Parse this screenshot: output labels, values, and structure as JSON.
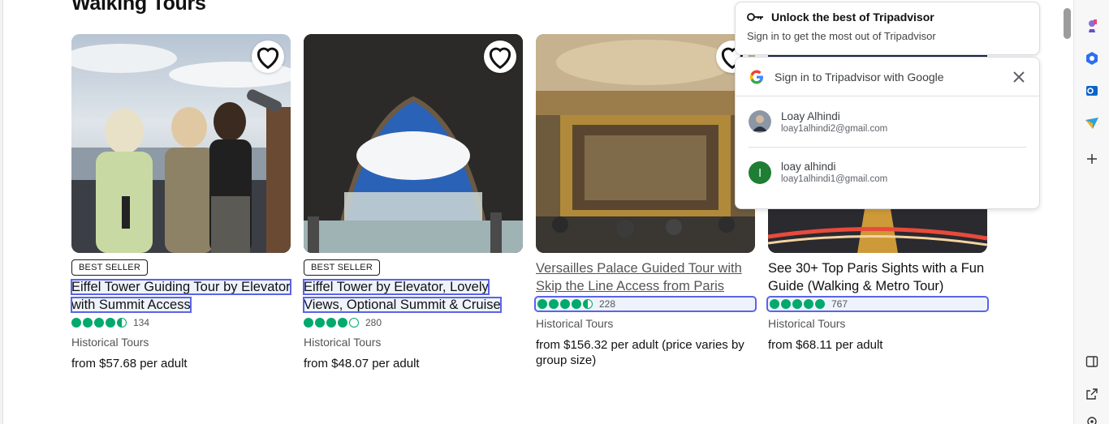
{
  "section": {
    "title": "Walking Tours"
  },
  "cards": [
    {
      "badge": "BEST SELLER",
      "title": "Eiffel Tower Guiding Tour by Elevator with Summit Access",
      "rating": 4.5,
      "reviews": "134",
      "category": "Historical Tours",
      "price": "from $57.68 per adult"
    },
    {
      "badge": "BEST SELLER",
      "title": "Eiffel Tower by Elevator, Lovely Views, Optional Summit & Cruise",
      "rating": 4,
      "reviews": "280",
      "category": "Historical Tours",
      "price": "from $48.07 per adult"
    },
    {
      "badge": "",
      "title": "Versailles Palace Guided Tour with Skip the Line Access from Paris",
      "rating": 4.5,
      "reviews": "228",
      "category": "Historical Tours",
      "price": "from $156.32 per adult (price varies by group size)"
    },
    {
      "badge": "",
      "title": "See 30+ Top Paris Sights with a Fun Guide (Walking & Metro Tour)",
      "rating": 5,
      "reviews": "767",
      "category": "Historical Tours",
      "price": "from $68.11 per adult"
    }
  ],
  "promo": {
    "heading": "Unlock the best of Tripadvisor",
    "subtext": "Sign in to get the most out of Tripadvisor",
    "icon": "key-icon"
  },
  "google_signin": {
    "title": "Sign in to Tripadvisor with Google",
    "accounts": [
      {
        "name": "Loay Alhindi",
        "email": "loay1alhindi2@gmail.com",
        "avatar": "photo"
      },
      {
        "name": "loay alhindi",
        "email": "loay1alhindi1@gmail.com",
        "avatar": "l"
      }
    ]
  },
  "colors": {
    "rating_green": "#00aa6c",
    "selection_outline": "#5b64e8",
    "google_avatar_green": "#1e7e34"
  }
}
